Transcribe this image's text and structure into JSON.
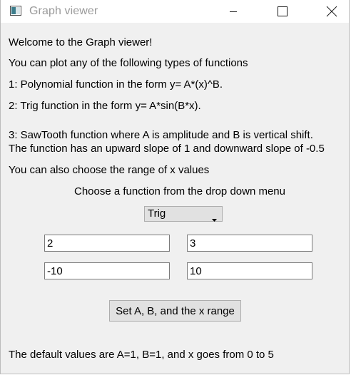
{
  "window": {
    "title": "Graph viewer"
  },
  "content": {
    "welcome": "Welcome to the Graph viewer!",
    "intro": "You can plot any of the following types of functions",
    "option_1": "1: Polynomial function in the form y= A*(x)^B.",
    "option_2": "2: Trig function in the form y= A*sin(B*x).",
    "option_3_line1": "3: SawTooth function where A is amplitude and B is vertical shift.",
    "option_3_line2": "The function has an upward slope of 1 and downward slope of -0.5",
    "range_note": "You can also choose the range of x values",
    "choose_prompt": "Choose a function from the drop down menu"
  },
  "function_select": {
    "selected": "Trig",
    "icon": "chevron-down-icon"
  },
  "inputs": {
    "a_value": "2",
    "b_value": "3",
    "x_min_value": "-10",
    "x_max_value": "10"
  },
  "set_button_label": "Set A, B, and the x range",
  "default_note": "The default values are A=1, B=1, and x goes from 0 to 5",
  "icons": {
    "app": "graph-app-icon",
    "minimize": "minimize-icon",
    "maximize": "maximize-icon",
    "close": "close-icon"
  }
}
